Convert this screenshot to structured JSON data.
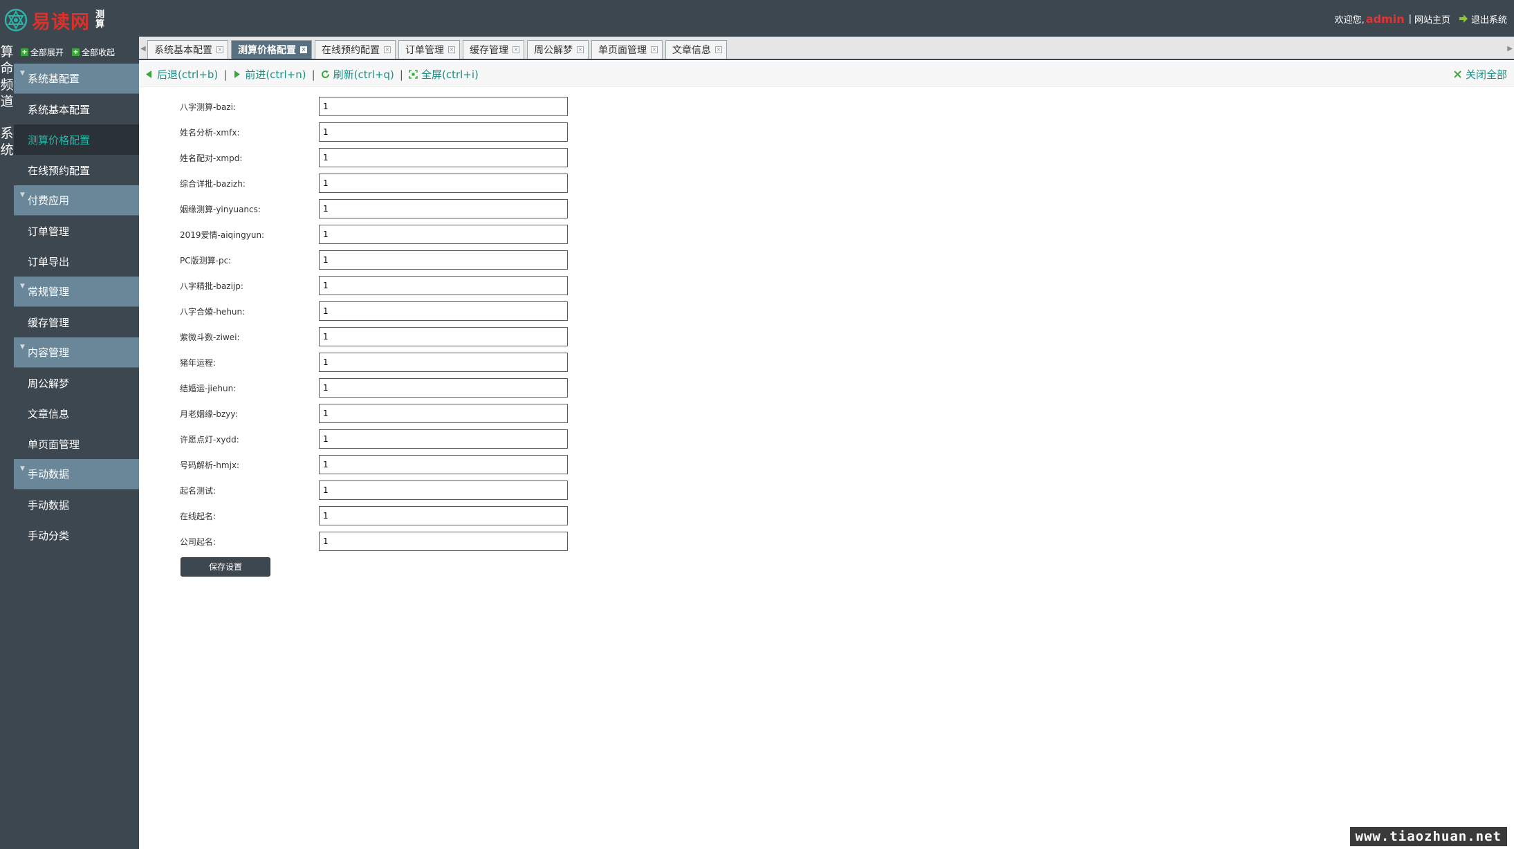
{
  "header": {
    "logo_text": "易读网",
    "logo_tag": "测算",
    "welcome": "欢迎您,",
    "username": "admin",
    "site_home": "网站主页",
    "logout": "退出系统"
  },
  "leftstrip": {
    "label1": "算命频道",
    "label2": "系统"
  },
  "sidebar": {
    "expand_all": "全部展开",
    "collapse_all": "全部收起",
    "groups": [
      {
        "label": "系统基配置",
        "items": [
          "系统基本配置",
          "测算价格配置",
          "在线预约配置"
        ]
      },
      {
        "label": "付费应用",
        "items": [
          "订单管理",
          "订单导出"
        ]
      },
      {
        "label": "常规管理",
        "items": [
          "缓存管理"
        ]
      },
      {
        "label": "内容管理",
        "items": [
          "周公解梦",
          "文章信息",
          "单页面管理"
        ]
      },
      {
        "label": "手动数据",
        "items": [
          "手动数据",
          "手动分类"
        ]
      }
    ],
    "active_item": "测算价格配置"
  },
  "tabs": [
    {
      "label": "系统基本配置",
      "active": false
    },
    {
      "label": "测算价格配置",
      "active": true
    },
    {
      "label": "在线预约配置",
      "active": false
    },
    {
      "label": "订单管理",
      "active": false
    },
    {
      "label": "缓存管理",
      "active": false
    },
    {
      "label": "周公解梦",
      "active": false
    },
    {
      "label": "单页面管理",
      "active": false
    },
    {
      "label": "文章信息",
      "active": false
    }
  ],
  "toolbar": {
    "back": "后退(ctrl+b)",
    "forward": "前进(ctrl+n)",
    "refresh": "刷新(ctrl+q)",
    "fullscreen": "全屏(ctrl+i)",
    "close_all": "关闭全部"
  },
  "form": {
    "fields": [
      {
        "label": "八字测算-bazi:",
        "value": "1"
      },
      {
        "label": "姓名分析-xmfx:",
        "value": "1"
      },
      {
        "label": "姓名配对-xmpd:",
        "value": "1"
      },
      {
        "label": "综合详批-bazizh:",
        "value": "1"
      },
      {
        "label": "姻缘测算-yinyuancs:",
        "value": "1"
      },
      {
        "label": "2019爱情-aiqingyun:",
        "value": "1"
      },
      {
        "label": "PC版测算-pc:",
        "value": "1"
      },
      {
        "label": "八字精批-bazijp:",
        "value": "1"
      },
      {
        "label": "八字合婚-hehun:",
        "value": "1"
      },
      {
        "label": "紫微斗数-ziwei:",
        "value": "1"
      },
      {
        "label": "猪年运程:",
        "value": "1"
      },
      {
        "label": "结婚运-jiehun:",
        "value": "1"
      },
      {
        "label": "月老姻缘-bzyy:",
        "value": "1"
      },
      {
        "label": "许愿点灯-xydd:",
        "value": "1"
      },
      {
        "label": "号码解析-hmjx:",
        "value": "1"
      },
      {
        "label": "起名测试:",
        "value": "1"
      },
      {
        "label": "在线起名:",
        "value": "1"
      },
      {
        "label": "公司起名:",
        "value": "1"
      }
    ],
    "save_label": "保存设置"
  },
  "watermark": "www.tiaozhuan.net",
  "colors": {
    "header_bg": "#3d4750",
    "group_bg": "#6a8799",
    "active_text": "#2fb3a7",
    "link_teal": "#1a8f86",
    "brand_red": "#d8322d"
  }
}
